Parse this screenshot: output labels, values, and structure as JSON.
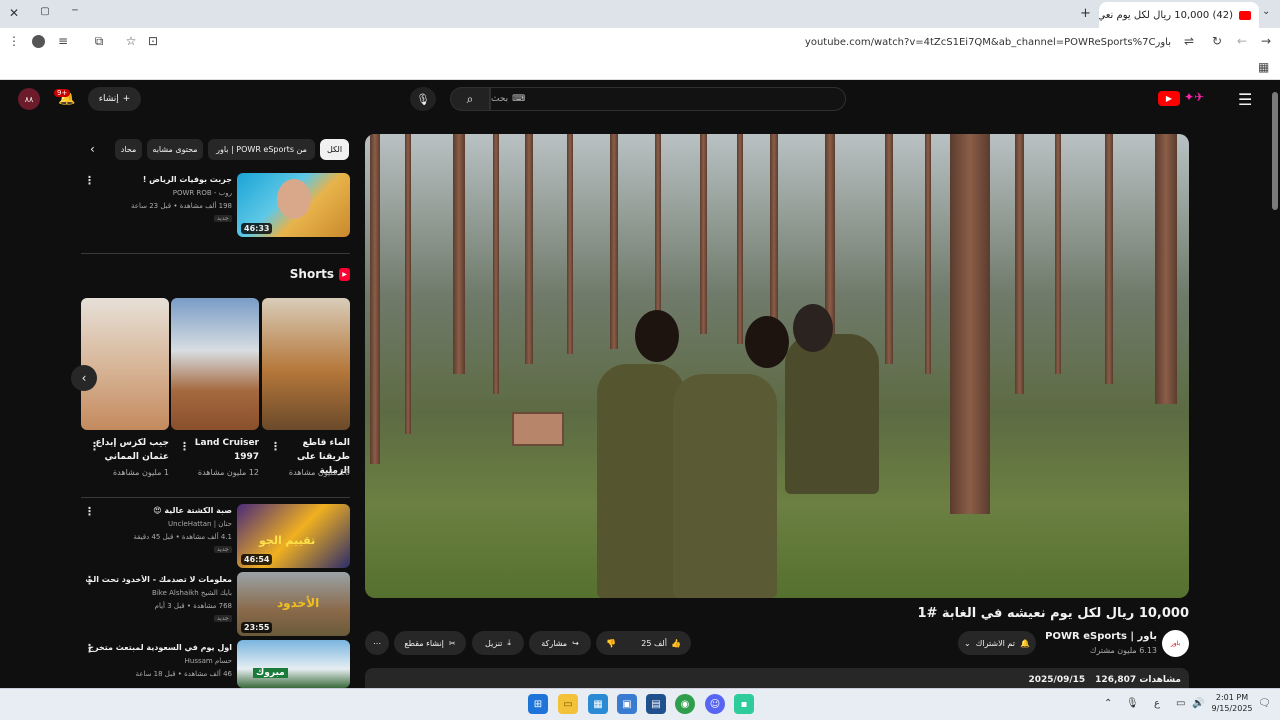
{
  "browser": {
    "tab_title": "(42) 10,000 ريال لكل يوم نعي",
    "url": "youtube.com/watch?v=4tZcS1Ei7QM&ab_channel=POWReSports%7Cباور",
    "window_minimize": "─",
    "window_restore": "▢",
    "window_close": "✕",
    "new_tab": "+"
  },
  "header": {
    "search_placeholder": "بحث",
    "create_label": "إنشاء",
    "notif_count": "9+",
    "avatar_text": "٨٨"
  },
  "chips": [
    "الكل",
    "من POWR eSports | باور",
    "محتوى مشابه",
    "محاد"
  ],
  "video": {
    "title": "10,000 ريال لكل يوم نعيشه في الغابة #1",
    "channel_name": "باور | POWR eSports",
    "channel_avatar_text": "باور",
    "subscribers": "6.13 مليون مشترك",
    "subscribe_label": "تم الاشتراك",
    "likes": "25 ألف",
    "share_label": "مشاركة",
    "download_label": "تنزيل",
    "clip_label": "إنشاء مقطع",
    "views": "126,807 مشاهدات",
    "date": "2025/09/15"
  },
  "sidebar": {
    "top_item": {
      "title": "جربت بوفيات الرياض !",
      "channel": "روب - POWR ROB",
      "meta": "198 ألف مشاهدة • قبل 23 ساعة",
      "badge": "جديد",
      "duration": "46:33"
    },
    "shorts_label": "Shorts",
    "shorts": [
      {
        "title": "الماء قاطع طريقنا على الرملية",
        "views": "10 مليون مشاهدة"
      },
      {
        "title": "Land Cruiser 1997",
        "views": "12 مليون مشاهدة"
      },
      {
        "title": "جيب لكزس إبداع عثمان المماني",
        "views": "1 مليون مشاهدة"
      }
    ],
    "items": [
      {
        "title": "صبة الكشتة عالية 😍",
        "channel": "حتان | UncleHattan",
        "meta": "4.1 ألف مشاهدة • قبل 45 دقيقة",
        "badge": "جديد",
        "duration": "46:54",
        "thumb_text": "تقييم الجو"
      },
      {
        "title": "معلومات لا تصدمك - الأخدود تحت المجهر",
        "channel": "بايك الشيخ Bike Alshaikh",
        "meta": "768 مشاهدة • قبل 3 أيام",
        "badge": "جديد",
        "duration": "23:55",
        "thumb_text": "الأخدود"
      },
      {
        "title": "اول يوم في السعودية لمبتعث متخرج",
        "channel": "حسام Hussam",
        "meta": "46 ألف مشاهدة • قبل 18 ساعة",
        "badge": "",
        "duration": "",
        "thumb_text": "مبروك"
      }
    ]
  },
  "taskbar": {
    "time": "2:01 PM",
    "date": "9/15/2025",
    "lang": "ع"
  },
  "colors": {
    "accent": "#ff0000",
    "bg": "#0f0f0f",
    "pill": "#272727"
  }
}
